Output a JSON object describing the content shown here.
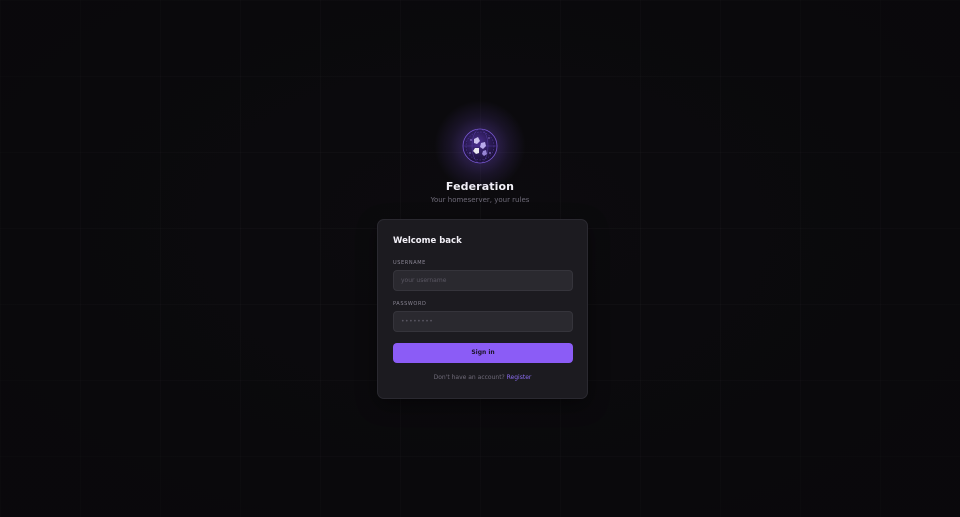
{
  "app": {
    "name": "Federation",
    "tagline": "Your homeserver, your rules",
    "logo_icon": "globe-orb-icon"
  },
  "login": {
    "title": "Welcome back",
    "username_label": "USERNAME",
    "username_placeholder": "your username",
    "username_value": "",
    "password_label": "PASSWORD",
    "password_placeholder": "••••••••",
    "password_value": "",
    "submit_label": "Sign in",
    "register_prompt": "Don't have an account?",
    "register_link": "Register"
  },
  "colors": {
    "background": "#0c0b0e",
    "card": "#1c1b20",
    "accent": "#8b5cf6",
    "link": "#8b6cf0"
  }
}
